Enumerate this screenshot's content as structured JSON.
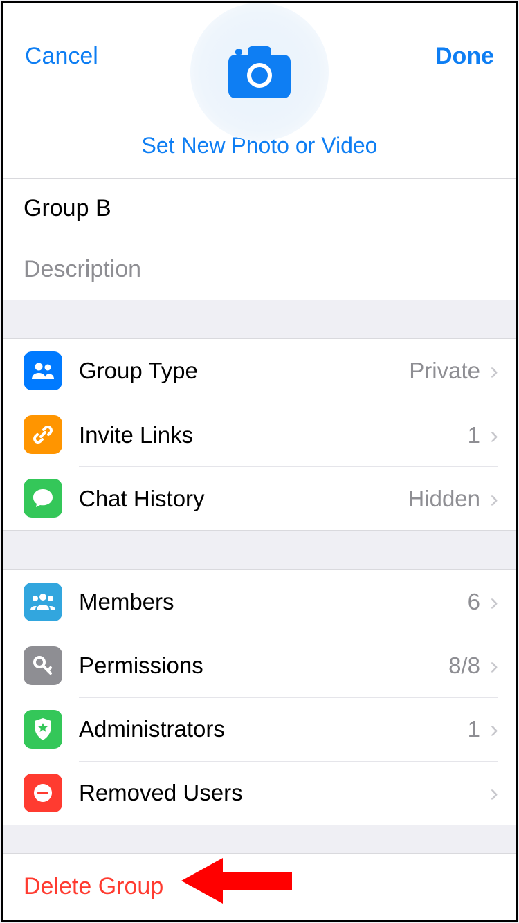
{
  "nav": {
    "cancel": "Cancel",
    "done": "Done"
  },
  "set_photo_label": "Set New Photo or Video",
  "group_name": "Group B",
  "description_placeholder": "Description",
  "description_value": "",
  "settings1": {
    "group_type": {
      "label": "Group Type",
      "value": "Private"
    },
    "invite_links": {
      "label": "Invite Links",
      "value": "1"
    },
    "chat_history": {
      "label": "Chat History",
      "value": "Hidden"
    }
  },
  "settings2": {
    "members": {
      "label": "Members",
      "value": "6"
    },
    "permissions": {
      "label": "Permissions",
      "value": "8/8"
    },
    "administrators": {
      "label": "Administrators",
      "value": "1"
    },
    "removed_users": {
      "label": "Removed Users",
      "value": ""
    }
  },
  "delete_label": "Delete Group",
  "colors": {
    "accent": "#0e7ef3",
    "destructive": "#ff3b30"
  }
}
